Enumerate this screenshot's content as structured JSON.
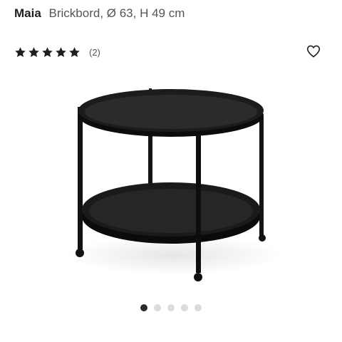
{
  "product": {
    "brand": "Maia",
    "subtitle": "Brickbord, Ø 63, H 49 cm"
  },
  "rating": {
    "stars": 5,
    "max_stars": 5,
    "review_count": "(2)",
    "icon": "star-icon",
    "star_color": "#1f1f1f"
  },
  "wishlist": {
    "icon": "heart-icon"
  },
  "gallery": {
    "image": "black-round-tray-side-table-on-casters",
    "total_images": 5,
    "active_index": 0,
    "active_color": "#2a2a2a",
    "inactive_color": "#dcdcdc"
  }
}
